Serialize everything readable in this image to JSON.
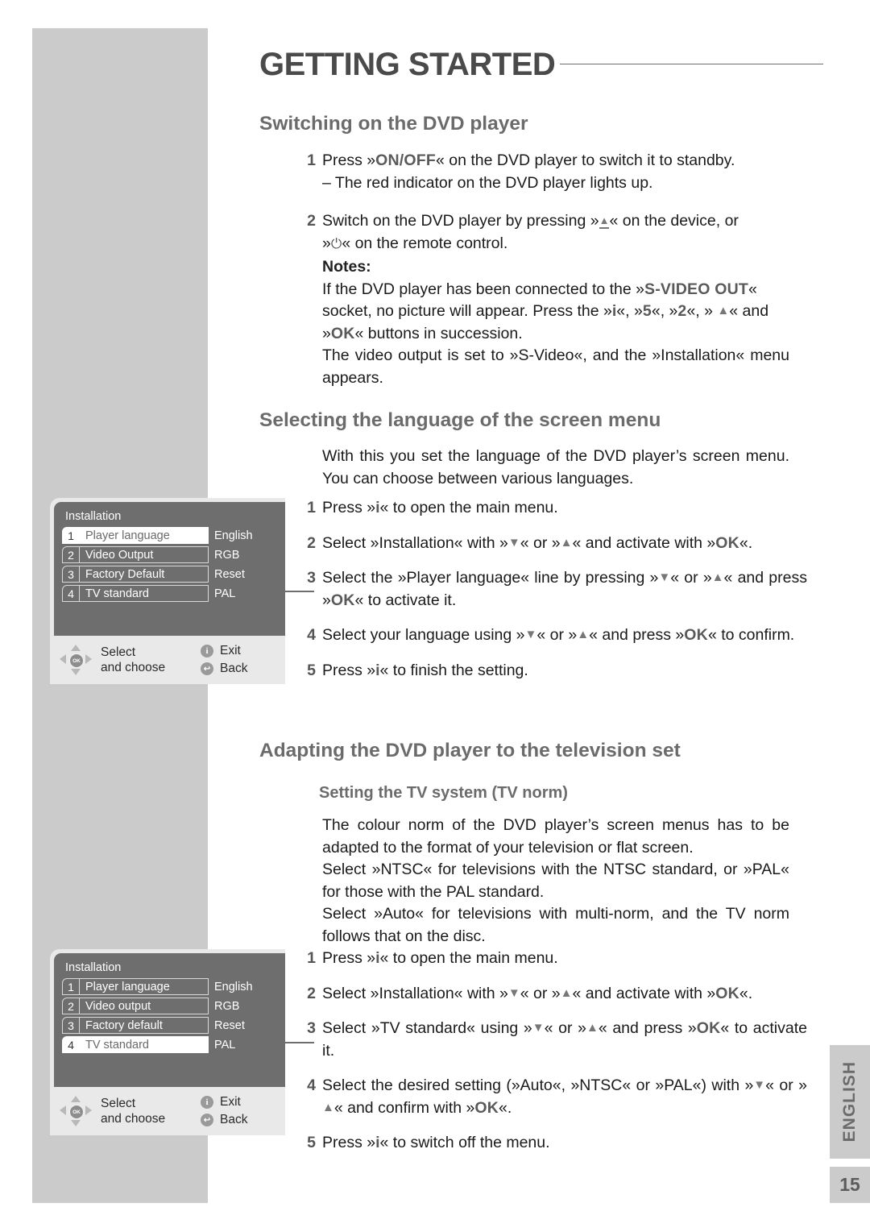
{
  "header": {
    "title": "GETTING STARTED"
  },
  "sections": {
    "switching": {
      "heading": "Switching on the DVD player",
      "steps": [
        {
          "num": "1",
          "line1_pre": "Press »",
          "line1_kb": "ON/OFF",
          "line1_post": "« on the DVD player to switch it to standby.",
          "line2": "– The red indicator on the DVD player lights up."
        },
        {
          "num": "2",
          "line1_pre": "Switch on the DVD player by pressing »",
          "line1_mid": "« on the device, or",
          "line2_pre": "»",
          "line2_post": "« on the remote control."
        }
      ],
      "notes": {
        "heading": "Notes:",
        "p1_a": "If the DVD player has been connected to the »",
        "p1_kb": "S-VIDEO OUT",
        "p1_b": "« socket, no picture will appear. Press the »",
        "p1_i": "i",
        "p1_c": "«, »",
        "p1_5": "5",
        "p1_d": "«, »",
        "p1_2": "2",
        "p1_e": "«, »",
        "p1_f": "« and »",
        "p1_ok": "OK",
        "p1_g": "« buttons in succession.",
        "p2": "The video output is set to »S-Video«, and the »Installation« menu appears."
      }
    },
    "language": {
      "heading": "Selecting the language of the screen menu",
      "intro": "With this you set the language of the DVD player’s screen menu. You can choose between various languages.",
      "steps": [
        {
          "num": "1",
          "a": "Press »",
          "i": "i",
          "b": "« to open the main menu."
        },
        {
          "num": "2",
          "a": "Select »Installation« with »",
          "b": "« or »",
          "c": "« and activate with »",
          "ok": "OK",
          "d": "«."
        },
        {
          "num": "3",
          "a": "Select the »Player language« line by pressing »",
          "b": "« or »",
          "c": "« and press »",
          "ok": "OK",
          "d": "« to activate it."
        },
        {
          "num": "4",
          "a": "Select your language using »",
          "b": "« or »",
          "c": "« and press »",
          "ok": "OK",
          "d": "« to confirm."
        },
        {
          "num": "5",
          "a": "Press »",
          "i": "i",
          "b": "« to finish the setting."
        }
      ]
    },
    "adapting": {
      "heading": "Adapting the DVD player to the television set",
      "subheading": "Setting the TV system (TV norm)",
      "p1": "The colour norm of the DVD player’s screen menus has to be adapted to the format of your television or flat screen.",
      "p2": "Select »NTSC« for televisions with the NTSC standard, or »PAL« for those with the PAL standard.",
      "p3": "Select »Auto« for televisions with multi-norm, and the TV norm follows that on the disc.",
      "steps": [
        {
          "num": "1",
          "a": "Press »",
          "i": "i",
          "b": "« to open the main menu."
        },
        {
          "num": "2",
          "a": "Select »Installation« with »",
          "b": "« or »",
          "c": "« and activate with »",
          "ok": "OK",
          "d": "«."
        },
        {
          "num": "3",
          "a": "Select »TV standard« using »",
          "b": "« or »",
          "c": "« and press »",
          "ok": "OK",
          "d": "« to activate it."
        },
        {
          "num": "4",
          "a": "Select the desired setting (»Auto«, »NTSC« or »PAL«) with »",
          "b": "« or »",
          "c": "« and confirm with »",
          "ok": "OK",
          "d": "«."
        },
        {
          "num": "5",
          "a": "Press »",
          "i": "i",
          "b": "« to switch off the menu."
        }
      ]
    }
  },
  "osd_menus": [
    {
      "title": "Installation",
      "rows": [
        {
          "index": "1",
          "label": "Player language",
          "value": "English",
          "selected": true
        },
        {
          "index": "2",
          "label": "Video Output",
          "value": "RGB",
          "selected": false
        },
        {
          "index": "3",
          "label": "Factory Default",
          "value": "Reset",
          "selected": false
        },
        {
          "index": "4",
          "label": "TV standard",
          "value": "PAL",
          "selected": false
        }
      ],
      "footer": {
        "select_line1": "Select",
        "select_line2": "and choose",
        "exit_glyph": "i",
        "exit_label": "Exit",
        "back_glyph": "↩",
        "back_label": "Back",
        "ok_label": "OK"
      }
    },
    {
      "title": "Installation",
      "rows": [
        {
          "index": "1",
          "label": "Player language",
          "value": "English",
          "selected": false
        },
        {
          "index": "2",
          "label": "Video output",
          "value": "RGB",
          "selected": false
        },
        {
          "index": "3",
          "label": "Factory default",
          "value": "Reset",
          "selected": false
        },
        {
          "index": "4",
          "label": "TV standard",
          "value": "PAL",
          "selected": true
        }
      ],
      "footer": {
        "select_line1": "Select",
        "select_line2": "and choose",
        "exit_glyph": "i",
        "exit_label": "Exit",
        "back_glyph": "↩",
        "back_label": "Back",
        "ok_label": "OK"
      }
    }
  ],
  "side_tabs": {
    "language": "ENGLISH",
    "page_number": "15"
  },
  "colors": {
    "panel_grey": "#cbcbcb",
    "heading_grey": "#6b6b6b",
    "osd_screen": "#6e6e6e",
    "osd_chrome": "#e9e9e9"
  }
}
